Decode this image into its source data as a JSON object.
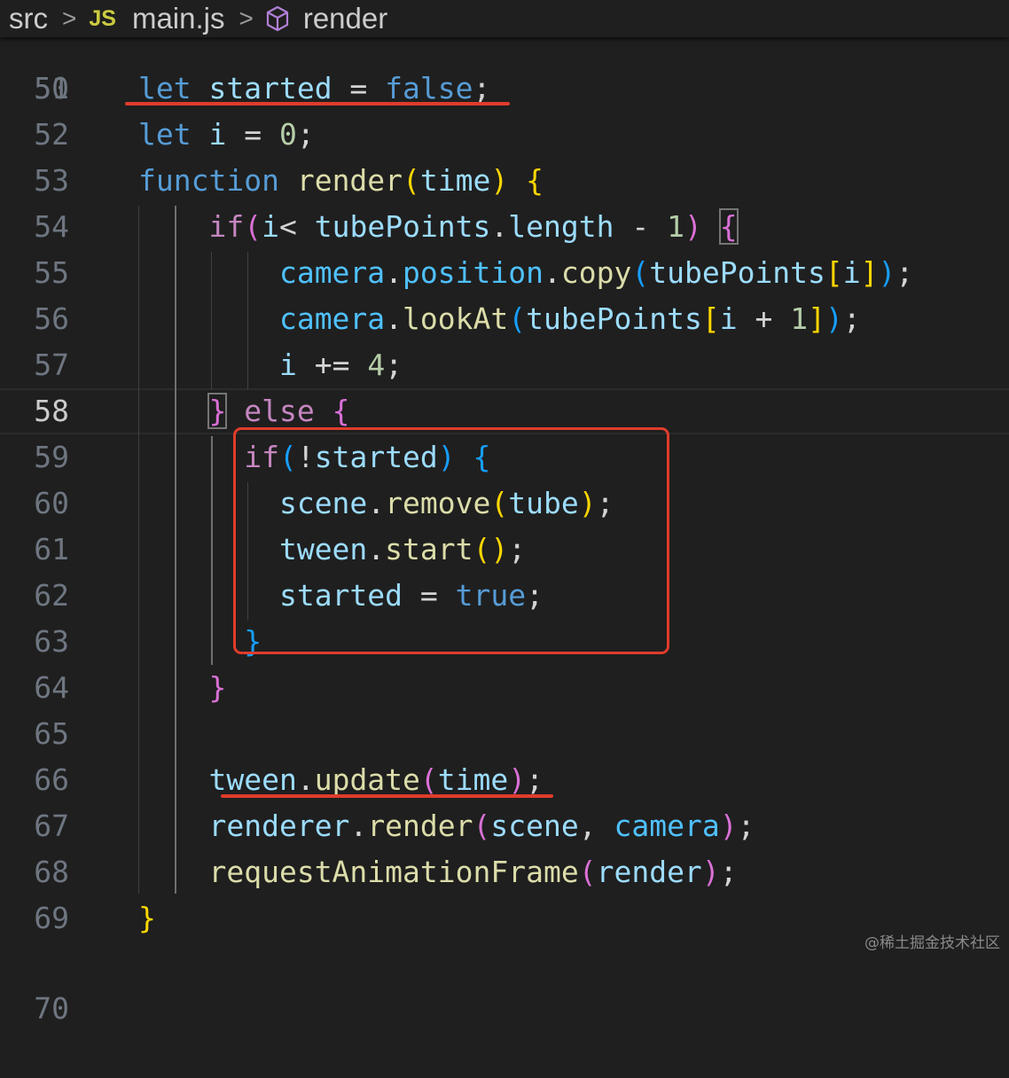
{
  "breadcrumb": {
    "segments": [
      "src",
      "main.js",
      "render"
    ],
    "separator": ">",
    "file_icon_text": "JS",
    "icons": [
      "js-file-icon",
      "symbol-method-icon"
    ]
  },
  "editor": {
    "language": "javascript",
    "theme": "dark",
    "current_line": "58",
    "partial_lines": [
      "50",
      "70"
    ],
    "lines": [
      {
        "num": "51",
        "tokens": [
          [
            "kw",
            "let"
          ],
          [
            "pl",
            " "
          ],
          [
            "var",
            "started"
          ],
          [
            "pl",
            " = "
          ],
          [
            "kw",
            "false"
          ],
          [
            "pl",
            ";"
          ]
        ]
      },
      {
        "num": "52",
        "tokens": [
          [
            "kw",
            "let"
          ],
          [
            "pl",
            " "
          ],
          [
            "var",
            "i"
          ],
          [
            "pl",
            " = "
          ],
          [
            "num",
            "0"
          ],
          [
            "pl",
            ";"
          ]
        ]
      },
      {
        "num": "53",
        "tokens": [
          [
            "kw",
            "function"
          ],
          [
            "pl",
            " "
          ],
          [
            "fn",
            "render"
          ],
          [
            "b1",
            "("
          ],
          [
            "var",
            "time"
          ],
          [
            "b1",
            ")"
          ],
          [
            "pl",
            " "
          ],
          [
            "b1",
            "{"
          ]
        ]
      },
      {
        "num": "54",
        "tokens": [
          [
            "pl",
            "    "
          ],
          [
            "ctl",
            "if"
          ],
          [
            "b2",
            "("
          ],
          [
            "var",
            "i"
          ],
          [
            "pl",
            "< "
          ],
          [
            "var",
            "tubePoints"
          ],
          [
            "pl",
            "."
          ],
          [
            "var",
            "length"
          ],
          [
            "pl",
            " - "
          ],
          [
            "num",
            "1"
          ],
          [
            "b2",
            ")"
          ],
          [
            "pl",
            " "
          ],
          [
            "b2bm",
            "{"
          ]
        ]
      },
      {
        "num": "55",
        "tokens": [
          [
            "pl",
            "        "
          ],
          [
            "prop",
            "camera"
          ],
          [
            "pl",
            "."
          ],
          [
            "prop",
            "position"
          ],
          [
            "pl",
            "."
          ],
          [
            "fn",
            "copy"
          ],
          [
            "b3",
            "("
          ],
          [
            "var",
            "tubePoints"
          ],
          [
            "b1",
            "["
          ],
          [
            "var",
            "i"
          ],
          [
            "b1",
            "]"
          ],
          [
            "b3",
            ")"
          ],
          [
            "pl",
            ";"
          ]
        ]
      },
      {
        "num": "56",
        "tokens": [
          [
            "pl",
            "        "
          ],
          [
            "prop",
            "camera"
          ],
          [
            "pl",
            "."
          ],
          [
            "fn",
            "lookAt"
          ],
          [
            "b3",
            "("
          ],
          [
            "var",
            "tubePoints"
          ],
          [
            "b1",
            "["
          ],
          [
            "var",
            "i"
          ],
          [
            "pl",
            " + "
          ],
          [
            "num",
            "1"
          ],
          [
            "b1",
            "]"
          ],
          [
            "b3",
            ")"
          ],
          [
            "pl",
            ";"
          ]
        ]
      },
      {
        "num": "57",
        "tokens": [
          [
            "pl",
            "        "
          ],
          [
            "var",
            "i"
          ],
          [
            "pl",
            " += "
          ],
          [
            "num",
            "4"
          ],
          [
            "pl",
            ";"
          ]
        ]
      },
      {
        "num": "58",
        "tokens": [
          [
            "pl",
            "    "
          ],
          [
            "b2bm",
            "}"
          ],
          [
            "pl",
            " "
          ],
          [
            "ctl",
            "else"
          ],
          [
            "pl",
            " "
          ],
          [
            "b2",
            "{"
          ]
        ]
      },
      {
        "num": "59",
        "tokens": [
          [
            "pl",
            "      "
          ],
          [
            "ctl",
            "if"
          ],
          [
            "b3",
            "("
          ],
          [
            "pl",
            "!"
          ],
          [
            "var",
            "started"
          ],
          [
            "b3",
            ")"
          ],
          [
            "pl",
            " "
          ],
          [
            "b3",
            "{"
          ]
        ]
      },
      {
        "num": "60",
        "tokens": [
          [
            "pl",
            "        "
          ],
          [
            "var",
            "scene"
          ],
          [
            "pl",
            "."
          ],
          [
            "fn",
            "remove"
          ],
          [
            "b1",
            "("
          ],
          [
            "var",
            "tube"
          ],
          [
            "b1",
            ")"
          ],
          [
            "pl",
            ";"
          ]
        ]
      },
      {
        "num": "61",
        "tokens": [
          [
            "pl",
            "        "
          ],
          [
            "var",
            "tween"
          ],
          [
            "pl",
            "."
          ],
          [
            "fn",
            "start"
          ],
          [
            "b1",
            "()"
          ],
          [
            "pl",
            ";"
          ]
        ]
      },
      {
        "num": "62",
        "tokens": [
          [
            "pl",
            "        "
          ],
          [
            "var",
            "started"
          ],
          [
            "pl",
            " = "
          ],
          [
            "kw",
            "true"
          ],
          [
            "pl",
            ";"
          ]
        ]
      },
      {
        "num": "63",
        "tokens": [
          [
            "pl",
            "      "
          ],
          [
            "b3",
            "}"
          ]
        ]
      },
      {
        "num": "64",
        "tokens": [
          [
            "pl",
            "    "
          ],
          [
            "b2",
            "}"
          ]
        ]
      },
      {
        "num": "65",
        "tokens": []
      },
      {
        "num": "66",
        "tokens": [
          [
            "pl",
            "    "
          ],
          [
            "var",
            "tween"
          ],
          [
            "pl",
            "."
          ],
          [
            "fn",
            "update"
          ],
          [
            "b2",
            "("
          ],
          [
            "var",
            "time"
          ],
          [
            "b2",
            ")"
          ],
          [
            "pl",
            ";"
          ]
        ]
      },
      {
        "num": "67",
        "tokens": [
          [
            "pl",
            "    "
          ],
          [
            "var",
            "renderer"
          ],
          [
            "pl",
            "."
          ],
          [
            "fn",
            "render"
          ],
          [
            "b2",
            "("
          ],
          [
            "var",
            "scene"
          ],
          [
            "pl",
            ", "
          ],
          [
            "prop",
            "camera"
          ],
          [
            "b2",
            ")"
          ],
          [
            "pl",
            ";"
          ]
        ]
      },
      {
        "num": "68",
        "tokens": [
          [
            "pl",
            "    "
          ],
          [
            "fn",
            "requestAnimationFrame"
          ],
          [
            "b2",
            "("
          ],
          [
            "var",
            "render"
          ],
          [
            "b2",
            ")"
          ],
          [
            "pl",
            ";"
          ]
        ]
      },
      {
        "num": "69",
        "tokens": [
          [
            "b1",
            "}"
          ]
        ]
      }
    ]
  },
  "annotations": {
    "underlined_statements": [
      "let started = false;",
      "tween.update(time);"
    ],
    "boxed_lines": [
      "59",
      "63"
    ],
    "accent_color": "#e03c2c"
  },
  "watermark": "@稀土掘金技术社区"
}
